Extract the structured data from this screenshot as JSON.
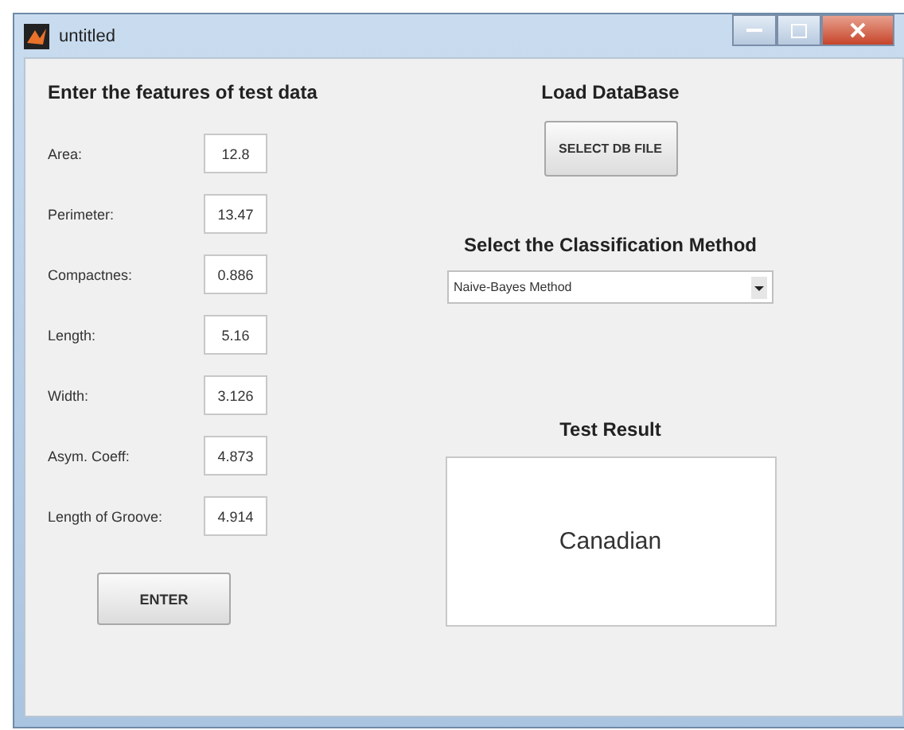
{
  "window": {
    "title": "untitled"
  },
  "features": {
    "heading": "Enter the features of test data",
    "fields": [
      {
        "label": "Area:",
        "value": "12.8"
      },
      {
        "label": "Perimeter:",
        "value": "13.47"
      },
      {
        "label": "Compactnes:",
        "value": "0.886"
      },
      {
        "label": "Length:",
        "value": "5.16"
      },
      {
        "label": "Width:",
        "value": "3.126"
      },
      {
        "label": "Asym. Coeff:",
        "value": "4.873"
      },
      {
        "label": "Length of Groove:",
        "value": "4.914"
      }
    ],
    "button": "ENTER"
  },
  "database": {
    "heading": "Load DataBase",
    "button": "SELECT DB FILE"
  },
  "classification": {
    "heading": "Select the Classification Method",
    "selected": "Naive-Bayes Method"
  },
  "result": {
    "heading": "Test Result",
    "value": "Canadian"
  }
}
